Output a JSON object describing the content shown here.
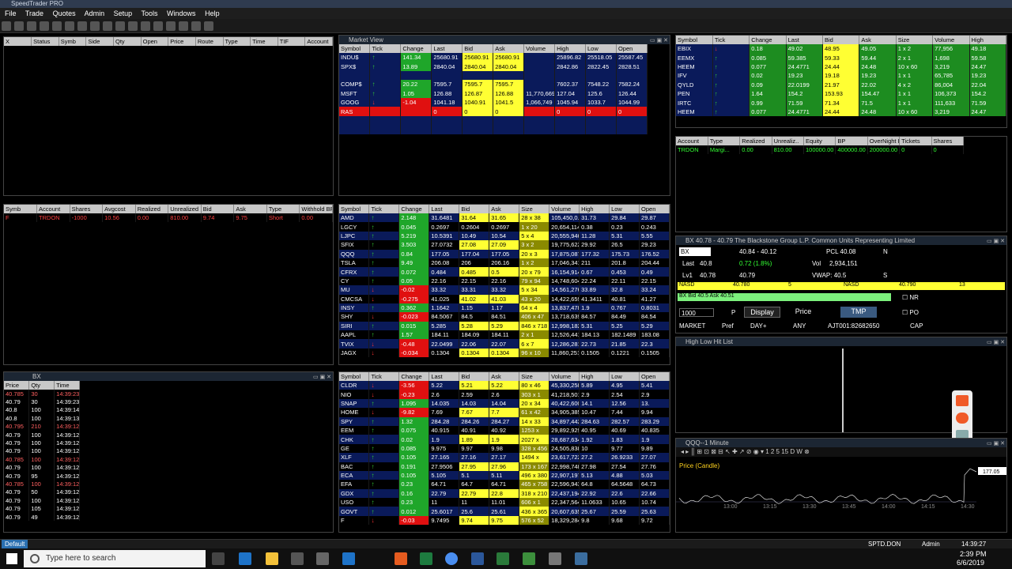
{
  "app": {
    "title": "SpeedTrader PRO",
    "menu": [
      "File",
      "Trade",
      "Quotes",
      "Admin",
      "Setup",
      "Tools",
      "Windows",
      "Help"
    ]
  },
  "orders": {
    "columns": [
      "X",
      "Status",
      "Symb",
      "Side",
      "Qty",
      "Open",
      "Price",
      "Route",
      "Type",
      "Time",
      "TIF",
      "Account"
    ]
  },
  "market_view": {
    "title": "Market View",
    "columns": [
      "Symbol",
      "Tick",
      "Change",
      "Last",
      "Bid",
      "Ask",
      "Volume",
      "High",
      "Low",
      "Open"
    ],
    "rows": [
      {
        "s": "INDU$",
        "t": "up",
        "c": "141.34",
        "l": "25680.91",
        "b": "25680.91",
        "a": "25680.91",
        "v": "",
        "h": "25896.82",
        "lo": "25518.05",
        "o": "25587.45"
      },
      {
        "s": "SPX$",
        "t": "up",
        "c": "13.89",
        "l": "2840.04",
        "b": "2840.04",
        "a": "2840.04",
        "v": "",
        "h": "2842.86",
        "lo": "2822.45",
        "o": "2828.51"
      },
      {
        "s": "",
        "t": "",
        "c": "",
        "l": "",
        "b": "",
        "a": "",
        "v": "",
        "h": "",
        "lo": "",
        "o": ""
      },
      {
        "s": "COMP$",
        "t": "up",
        "c": "20.22",
        "l": "7595.7",
        "b": "7595.7",
        "a": "7595.7",
        "v": "",
        "h": "7602.37",
        "lo": "7548.22",
        "o": "7582.24"
      },
      {
        "s": "MSFT",
        "t": "up",
        "c": "1.05",
        "l": "126.88",
        "b": "126.87",
        "a": "126.88",
        "v": "11,770,669",
        "h": "127.04",
        "lo": "125.6",
        "o": "126.44"
      },
      {
        "s": "GOOG",
        "t": "dn",
        "c": "-1.04",
        "l": "1041.18",
        "b": "1040.91",
        "a": "1041.5",
        "v": "1,066,749",
        "h": "1045.94",
        "lo": "1033.7",
        "o": "1044.99"
      },
      {
        "s": "RAS",
        "t": "red",
        "c": "",
        "l": "0",
        "b": "0",
        "a": "0",
        "v": "",
        "h": "0",
        "lo": "0",
        "o": "0"
      }
    ]
  },
  "ticker_top": {
    "columns": [
      "Symbol",
      "Tick",
      "Change",
      "Last",
      "Bid",
      "Ask",
      "Size",
      "Volume",
      "High"
    ],
    "rows": [
      {
        "s": "EBIX",
        "t": "dn",
        "c": "0.18",
        "l": "49.02",
        "b": "48.95",
        "a": "49.05",
        "z": "1 x 2",
        "v": "77,956",
        "h": "49.18"
      },
      {
        "s": "EEMX",
        "t": "up",
        "c": "0.085",
        "l": "59.385",
        "b": "59.33",
        "a": "59.44",
        "z": "2 x 1",
        "v": "1,698",
        "h": "59.58"
      },
      {
        "s": "HEEM",
        "t": "up",
        "c": "0.077",
        "l": "24.4771",
        "b": "24.44",
        "a": "24.48",
        "z": "10 x 60",
        "v": "3,219",
        "h": "24.47"
      },
      {
        "s": "IFV",
        "t": "up",
        "c": "0.02",
        "l": "19.23",
        "b": "19.18",
        "a": "19.23",
        "z": "1 x 1",
        "v": "65,785",
        "h": "19.23"
      },
      {
        "s": "QYLD",
        "t": "up",
        "c": "0.09",
        "l": "22.0199",
        "b": "21.97",
        "a": "22.02",
        "z": "4 x 2",
        "v": "86,004",
        "h": "22.04"
      },
      {
        "s": "PEN",
        "t": "up",
        "c": "1.64",
        "l": "154.2",
        "b": "153.93",
        "a": "154.47",
        "z": "1 x 1",
        "v": "106,373",
        "h": "154.2"
      },
      {
        "s": "IRTC",
        "t": "up",
        "c": "0.99",
        "l": "71.59",
        "b": "71.34",
        "a": "71.5",
        "z": "1 x 1",
        "v": "111,633",
        "h": "71.59"
      },
      {
        "s": "HEEM",
        "t": "up",
        "c": "0.077",
        "l": "24.4771",
        "b": "24.44",
        "a": "24.48",
        "z": "10 x 60",
        "v": "3,219",
        "h": "24.47"
      }
    ]
  },
  "account": {
    "columns": [
      "Account",
      "Type",
      "Realized",
      "Unrealiz..",
      "Equity",
      "BP",
      "OverNight BP",
      "Tickets",
      "Shares"
    ],
    "row": [
      "TRDON",
      "Margi...",
      "0.00",
      "810.00",
      "100000.00",
      "400000.00",
      "200000.00",
      "0",
      "0"
    ]
  },
  "positions": {
    "columns": [
      "Symb",
      "Account",
      "Shares",
      "Avgcost",
      "Realized",
      "Unrealized",
      "Bid",
      "Ask",
      "Type",
      "Withhold BP"
    ],
    "row": [
      "F",
      "TRDON",
      "-1000",
      "10.56",
      "0.00",
      "810.00",
      "9.74",
      "9.75",
      "Short",
      "0.00"
    ]
  },
  "watch": {
    "columns": [
      "Symbol",
      "Tick",
      "Change",
      "Last",
      "Bid",
      "Ask",
      "Size",
      "Volume",
      "High",
      "Low",
      "Open"
    ],
    "rows": [
      {
        "s": "AMD",
        "c": "2.148",
        "d": "u",
        "l": "31.6481",
        "b": "31.64",
        "a": "31.65",
        "z": "28 x 38",
        "v": "105,450,0...",
        "h": "31.73",
        "lo": "29.84",
        "o": "29.87"
      },
      {
        "s": "LGCY",
        "c": "0.045",
        "d": "u",
        "l": "0.2697",
        "b": "0.2604",
        "a": "0.2697",
        "z": "1 x 20",
        "v": "20,654,114",
        "h": "0.38",
        "lo": "0.23",
        "o": "0.243"
      },
      {
        "s": "LJPC",
        "c": "5.219",
        "d": "u",
        "l": "10.5391",
        "b": "10.49",
        "a": "10.54",
        "z": "5 x 4",
        "v": "20,555,946",
        "h": "11.28",
        "lo": "5.31",
        "o": "5.55"
      },
      {
        "s": "SFIX",
        "c": "3.503",
        "d": "u",
        "l": "27.0732",
        "b": "27.08",
        "a": "27.09",
        "z": "3 x 2",
        "v": "19,775,622",
        "h": "29.92",
        "lo": "26.5",
        "o": "29.23"
      },
      {
        "s": "QQQ",
        "c": "0.84",
        "d": "u",
        "l": "177.05",
        "b": "177.04",
        "a": "177.05",
        "z": "20 x 3",
        "v": "17,875,087",
        "h": "177.32",
        "lo": "175.73",
        "o": "176.52"
      },
      {
        "s": "TSLA",
        "c": "9.49",
        "d": "u",
        "l": "206.08",
        "b": "206",
        "a": "206.16",
        "z": "1 x 2",
        "v": "17,046,341",
        "h": "211",
        "lo": "201.8",
        "o": "204.44"
      },
      {
        "s": "CFRX",
        "c": "0.072",
        "d": "u",
        "l": "0.484",
        "b": "0.485",
        "a": "0.5",
        "z": "20 x 79",
        "v": "16,154,914",
        "h": "0.67",
        "lo": "0.453",
        "o": "0.49"
      },
      {
        "s": "CY",
        "c": "0.05",
        "d": "u",
        "l": "22.16",
        "b": "22.15",
        "a": "22.16",
        "z": "79 x 94",
        "v": "14,748,604",
        "h": "22.24",
        "lo": "22.11",
        "o": "22.15"
      },
      {
        "s": "MU",
        "c": "-0.02",
        "d": "d",
        "l": "33.32",
        "b": "33.31",
        "a": "33.32",
        "z": "5 x 34",
        "v": "14,561,276",
        "h": "33.89",
        "lo": "32.8",
        "o": "33.24"
      },
      {
        "s": "CMCSA",
        "c": "-0.275",
        "d": "d",
        "l": "41.025",
        "b": "41.02",
        "a": "41.03",
        "z": "43 x 20",
        "v": "14,422,659",
        "h": "41.3411",
        "lo": "40.81",
        "o": "41.27"
      },
      {
        "s": "INSY",
        "c": "0.362",
        "d": "u",
        "l": "1.1642",
        "b": "1.15",
        "a": "1.17",
        "z": "64 x 4",
        "v": "13,837,478",
        "h": "1.9",
        "lo": "0.767",
        "o": "0.8031"
      },
      {
        "s": "SHY",
        "c": "-0.023",
        "d": "d",
        "l": "84.5067",
        "b": "84.5",
        "a": "84.51",
        "z": "406 x 47",
        "v": "13,718,639",
        "h": "84.57",
        "lo": "84.49",
        "o": "84.54"
      },
      {
        "s": "SIRI",
        "c": "0.015",
        "d": "u",
        "l": "5.285",
        "b": "5.28",
        "a": "5.29",
        "z": "846 x 718",
        "v": "12,998,182",
        "h": "5.31",
        "lo": "5.25",
        "o": "5.29"
      },
      {
        "s": "AAPL",
        "c": "1.57",
        "d": "u",
        "l": "184.11",
        "b": "184.09",
        "a": "184.11",
        "z": "2 x 1",
        "v": "12,526,441",
        "h": "184.13",
        "lo": "182.1489",
        "o": "183.08"
      },
      {
        "s": "TVIX",
        "c": "-0.48",
        "d": "d",
        "l": "22.0499",
        "b": "22.06",
        "a": "22.07",
        "z": "6 x 7",
        "v": "12,286,281",
        "h": "22.73",
        "lo": "21.85",
        "o": "22.3"
      },
      {
        "s": "JAGX",
        "c": "-0.034",
        "d": "d",
        "l": "0.1304",
        "b": "0.1304",
        "a": "0.1304",
        "z": "96 x 10",
        "v": "11,860,251",
        "h": "0.1505",
        "lo": "0.1221",
        "o": "0.1505"
      }
    ]
  },
  "watch2": {
    "columns": [
      "Symbol",
      "Tick",
      "Change",
      "Last",
      "Bid",
      "Ask",
      "Size",
      "Volume",
      "High",
      "Low",
      "Open"
    ],
    "rows": [
      {
        "s": "CLDR",
        "c": "-3.56",
        "d": "d",
        "l": "5.22",
        "b": "5.21",
        "a": "5.22",
        "z": "80 x 46",
        "v": "45,330,258",
        "h": "5.89",
        "lo": "4.95",
        "o": "5.41"
      },
      {
        "s": "NIO",
        "c": "-0.23",
        "d": "d",
        "l": "2.6",
        "b": "2.59",
        "a": "2.6",
        "z": "303 x 1",
        "v": "41,218,501",
        "h": "2.9",
        "lo": "2.54",
        "o": "2.9"
      },
      {
        "s": "SNAP",
        "c": "1.095",
        "d": "u",
        "l": "14.035",
        "b": "14.03",
        "a": "14.04",
        "z": "20 x 34",
        "v": "40,422,600",
        "h": "14.1",
        "lo": "12.56",
        "o": "13."
      },
      {
        "s": "HOME",
        "c": "-9.82",
        "d": "d",
        "l": "7.69",
        "b": "7.67",
        "a": "7.7",
        "z": "61 x 42",
        "v": "34,905,385",
        "h": "10.47",
        "lo": "7.44",
        "o": "9.94"
      },
      {
        "s": "SPY",
        "c": "1.32",
        "d": "u",
        "l": "284.28",
        "b": "284.26",
        "a": "284.27",
        "z": "14 x 33",
        "v": "34,897,442",
        "h": "284.63",
        "lo": "282.57",
        "o": "283.29"
      },
      {
        "s": "EEM",
        "c": "0.075",
        "d": "u",
        "l": "40.915",
        "b": "40.91",
        "a": "40.92",
        "z": "1253 x",
        "v": "29,892,929",
        "h": "40.95",
        "lo": "40.69",
        "o": "40.835"
      },
      {
        "s": "CHK",
        "c": "0.02",
        "d": "u",
        "l": "1.9",
        "b": "1.89",
        "a": "1.9",
        "z": "2027 x",
        "v": "28,687,634",
        "h": "1.92",
        "lo": "1.83",
        "o": "1.9"
      },
      {
        "s": "GE",
        "c": "0.085",
        "d": "u",
        "l": "9.975",
        "b": "9.97",
        "a": "9.98",
        "z": "328 x 456",
        "v": "24,505,838",
        "h": "10",
        "lo": "9.77",
        "o": "9.89"
      },
      {
        "s": "XLF",
        "c": "0.105",
        "d": "u",
        "l": "27.165",
        "b": "27.16",
        "a": "27.17",
        "z": "1494 x",
        "v": "23,617,722",
        "h": "27.2",
        "lo": "26.9233",
        "o": "27.07"
      },
      {
        "s": "BAC",
        "c": "0.191",
        "d": "u",
        "l": "27.9506",
        "b": "27.95",
        "a": "27.96",
        "z": "173 x 167",
        "v": "22,998,748",
        "h": "27.98",
        "lo": "27.54",
        "o": "27.76"
      },
      {
        "s": "ECA",
        "c": "0.105",
        "d": "u",
        "l": "5.105",
        "b": "5.1",
        "a": "5.11",
        "z": "496 x 380",
        "v": "22,907,197",
        "h": "5.13",
        "lo": "4.88",
        "o": "5.03"
      },
      {
        "s": "EFA",
        "c": "0.23",
        "d": "u",
        "l": "64.71",
        "b": "64.7",
        "a": "64.71",
        "z": "465 x 758",
        "v": "22,596,943",
        "h": "64.8",
        "lo": "64.5648",
        "o": "64.73"
      },
      {
        "s": "GDX",
        "c": "0.16",
        "d": "u",
        "l": "22.79",
        "b": "22.79",
        "a": "22.8",
        "z": "318 x 210",
        "v": "22,437,194",
        "h": "22.92",
        "lo": "22.6",
        "o": "22.66"
      },
      {
        "s": "USO",
        "c": "0.23",
        "d": "u",
        "l": "11",
        "b": "11",
        "a": "11.01",
        "z": "606 x 1",
        "v": "22,347,564",
        "h": "11.0633",
        "lo": "10.65",
        "o": "10.74"
      },
      {
        "s": "GOVT",
        "c": "0.012",
        "d": "u",
        "l": "25.6017",
        "b": "25.6",
        "a": "25.61",
        "z": "436 x 365",
        "v": "20,607,635",
        "h": "25.67",
        "lo": "25.59",
        "o": "25.63"
      },
      {
        "s": "F",
        "c": "-0.03",
        "d": "d",
        "l": "9.7495",
        "b": "9.74",
        "a": "9.75",
        "z": "576 x 52",
        "v": "18,329,284",
        "h": "9.8",
        "lo": "9.68",
        "o": "9.72"
      }
    ]
  },
  "tns": {
    "title": "BX",
    "columns": [
      "Price",
      "Qty",
      "Time"
    ],
    "rows": [
      [
        "40.785",
        "30",
        "14:39:23"
      ],
      [
        "40.79",
        "30",
        "14:39:23"
      ],
      [
        "40.8",
        "100",
        "14:39:14"
      ],
      [
        "40.8",
        "100",
        "14:39:13"
      ],
      [
        "40.795",
        "210",
        "14:39:12"
      ],
      [
        "40.79",
        "100",
        "14:39:12"
      ],
      [
        "40.79",
        "100",
        "14:39:12"
      ],
      [
        "40.79",
        "100",
        "14:39:12"
      ],
      [
        "40.785",
        "100",
        "14:39:12"
      ],
      [
        "40.79",
        "100",
        "14:39:12"
      ],
      [
        "40.79",
        "95",
        "14:39:12"
      ],
      [
        "40.785",
        "100",
        "14:39:12"
      ],
      [
        "40.79",
        "50",
        "14:39:12"
      ],
      [
        "40.79",
        "100",
        "14:39:12"
      ],
      [
        "40.79",
        "105",
        "14:39:12"
      ],
      [
        "40.79",
        "49",
        "14:39:12"
      ]
    ]
  },
  "level2": {
    "title": "BX   40.78 - 40.79   The Blackstone Group L.P. Common Units Representing Limited",
    "sym": "BX",
    "range": "40.84 - 40.12",
    "pcl": "PCL  40.08",
    "n": "N",
    "last_lbl": "Last",
    "last": "40.8",
    "chg": "0.72  (1.8%)",
    "vol_lbl": "Vol",
    "vol": "2,934,151",
    "lv1_lbl": "Lv1",
    "lv1_bid": "40.78",
    "lv1_ask": "40.79",
    "vwap": "VWAP: 40.5",
    "s": "S",
    "bid_mm": "NASD",
    "bid_px": "40.780",
    "bid_sz": "5",
    "ask_mm": "NASD",
    "ask_px": "40.790",
    "ask_sz": "13",
    "bidask": "BX Bid 40.5 Ask 40.51",
    "qty": "1000",
    "p": "P",
    "display": "Display",
    "price": "Price",
    "tmp": "TMP",
    "nr": "NR",
    "po": "PO",
    "market": "MARKET",
    "pref": "Pref",
    "day": "DAY+",
    "any": "ANY",
    "acct": "AJT001:82682650",
    "cap": "CAP"
  },
  "hilo": {
    "title": "High Low Hit List"
  },
  "chart": {
    "title": "QQQ--1 Minute",
    "series_label": "Price (Candle)",
    "xticks": [
      "13:00",
      "13:15",
      "13:30",
      "13:45",
      "14:00",
      "14:15",
      "14:30"
    ],
    "last_px": "177.05"
  },
  "status": {
    "default": "Default",
    "user": "SPTD.DON",
    "role": "Admin",
    "time": "14:39:27"
  },
  "taskbar": {
    "search": "Type here to search",
    "clock": "2:39 PM",
    "date": "6/6/2019"
  }
}
